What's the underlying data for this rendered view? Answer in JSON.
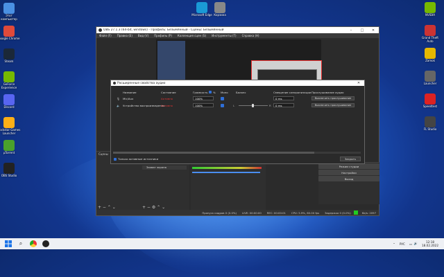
{
  "desktop_icons_left": [
    {
      "icon": "recycle-bin-icon",
      "label": "Этот компьютер",
      "color": "#4a90e2"
    },
    {
      "icon": "chrome-icon",
      "label": "Google Chrome",
      "color": "#e04a3a"
    },
    {
      "icon": "steam-icon",
      "label": "Steam",
      "color": "#1b2838"
    },
    {
      "icon": "nvidia-icon",
      "label": "GeForce Experience",
      "color": "#76b900"
    },
    {
      "icon": "discord-icon",
      "label": "Discord",
      "color": "#5865f2"
    },
    {
      "icon": "rockstar-icon",
      "label": "Rockstar Games Launcher",
      "color": "#fcaf17"
    },
    {
      "icon": "utorrent-icon",
      "label": "µTorrent",
      "color": "#4aa02c"
    },
    {
      "icon": "obs-icon",
      "label": "OBS Studio",
      "color": "#222"
    }
  ],
  "desktop_icons_top": [
    {
      "icon": "edge-icon",
      "label": "Microsoft Edge",
      "color": "#1a9ad6"
    },
    {
      "icon": "recycle-icon",
      "label": "Корзина",
      "color": "#888"
    }
  ],
  "desktop_icons_right": [
    {
      "icon": "nvidia-app-icon",
      "label": "NVIDIA",
      "color": "#76b900"
    },
    {
      "icon": "game-icon",
      "label": "Grand Theft Auto",
      "color": "#c33"
    },
    {
      "icon": "star-icon",
      "label": "Zamok",
      "color": "#e6b800"
    },
    {
      "icon": "launcher-icon",
      "label": "Launcher",
      "color": "#666"
    },
    {
      "icon": "red-app-icon",
      "label": "Speedtest",
      "color": "#d22"
    },
    {
      "icon": "audio-icon",
      "label": "FL Studio",
      "color": "#444"
    }
  ],
  "obs": {
    "title": "OBS 27.1.3 (64-bit, windows) - Профиль: Безымянный - Сцены: Безымянный",
    "menu": [
      "Файл (F)",
      "Правка (E)",
      "Вид (V)",
      "Профиль (P)",
      "Коллекция сцен (S)",
      "Инструменты (T)",
      "Справка (H)"
    ],
    "scenes_title": "Сцены",
    "sources_item": "Захват экрана",
    "controls": [
      "Режим студии",
      "Настройки",
      "Выход"
    ],
    "status": [
      "Пропуск кадров 0 (0.0%)",
      "LIVE: 00:00:00",
      "REC: 00:00:01",
      "CPU: 5.9%, 60.00 fps",
      "Задержка 0 (0.0%)",
      "Kb/s: 2097"
    ]
  },
  "dialog": {
    "title": "Расширенные свойства аудио",
    "headers": [
      "Название",
      "Состояние",
      "Громкость",
      "%",
      "Моно",
      "Баланс",
      "Смещение синхронизации",
      "Прослушивание аудио"
    ],
    "rows": [
      {
        "name": "Mic/Aux",
        "state": "Активно",
        "volume": "100%",
        "sync": "0 ms",
        "monitor": "Выключить прослушивание"
      },
      {
        "name": "Устройство воспроизведения",
        "state": "Активно",
        "volume": "100%",
        "sync": "0 ms",
        "monitor": "Выключить прослушивание"
      }
    ],
    "balance_left": "L",
    "balance_right": "R",
    "only_active": "Только активные источники",
    "close": "Закрыть"
  },
  "taskbar": {
    "lang": "РУС",
    "time": "12:18",
    "date": "18.02.2022"
  }
}
